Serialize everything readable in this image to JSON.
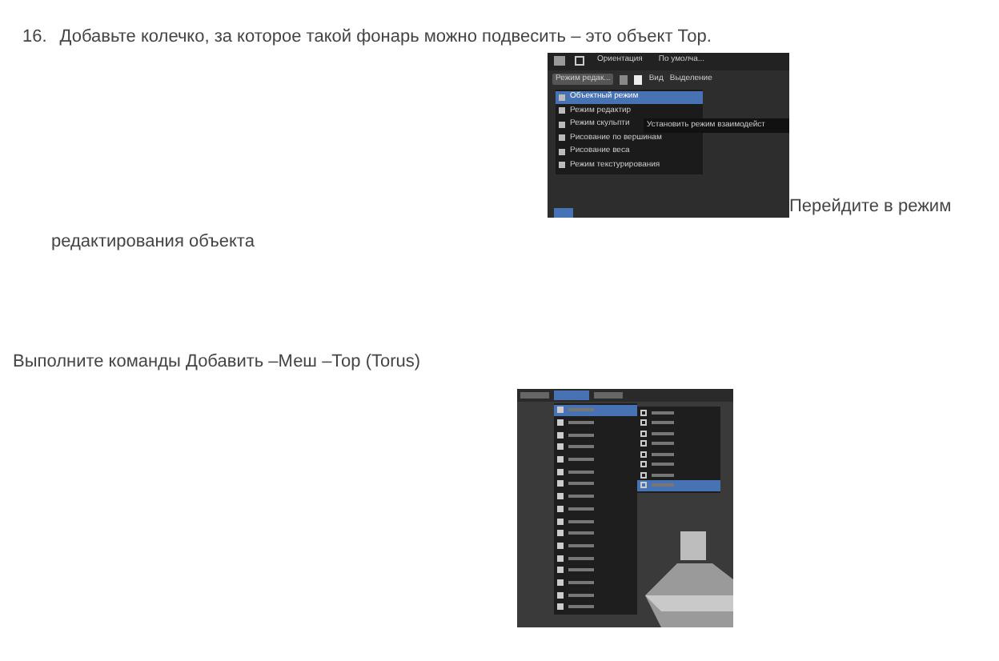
{
  "step": {
    "number": "16.",
    "text": "Добавьте колечко, за которое такой фонарь можно подвесить – это объект Тор."
  },
  "screenshot_1": {
    "header": [
      "Ориентация",
      "По умолча..."
    ],
    "mode_button": "Режим редак...",
    "toolbar": [
      "Вид",
      "Выделение"
    ],
    "menu_items": [
      {
        "label": "Объектный режим",
        "selected": true
      },
      {
        "label": "Режим редактир",
        "selected": false
      },
      {
        "label": "Режим скульпти",
        "selected": false
      },
      {
        "label": "Рисование по вершинам",
        "selected": false
      },
      {
        "label": "Рисование веса",
        "selected": false
      },
      {
        "label": "Режим текстурирования",
        "selected": false
      }
    ],
    "tooltip": "Установить режим взаимодейст"
  },
  "after_image": "Перейдите в режим",
  "continuation": "редактирования объекта",
  "instruction": "Выполните команды Добавить –Меш –Тор (Torus)",
  "screenshot_2": {
    "tabs": [
      {
        "selected": false
      },
      {
        "selected": true
      },
      {
        "selected": false
      }
    ],
    "menu_items": [
      {
        "selected": true
      },
      {
        "selected": false
      },
      {
        "selected": false
      },
      {
        "selected": false
      },
      {
        "selected": false
      },
      {
        "selected": false
      },
      {
        "selected": false
      },
      {
        "selected": false
      },
      {
        "selected": false
      },
      {
        "selected": false
      },
      {
        "selected": false
      },
      {
        "selected": false
      },
      {
        "selected": false
      },
      {
        "selected": false
      },
      {
        "selected": false
      },
      {
        "selected": false
      },
      {
        "selected": false
      }
    ],
    "submenu_items": [
      {
        "selected": false
      },
      {
        "selected": false
      },
      {
        "selected": false
      },
      {
        "selected": false
      },
      {
        "selected": false
      },
      {
        "selected": false
      },
      {
        "selected": false
      },
      {
        "selected": true
      }
    ]
  }
}
